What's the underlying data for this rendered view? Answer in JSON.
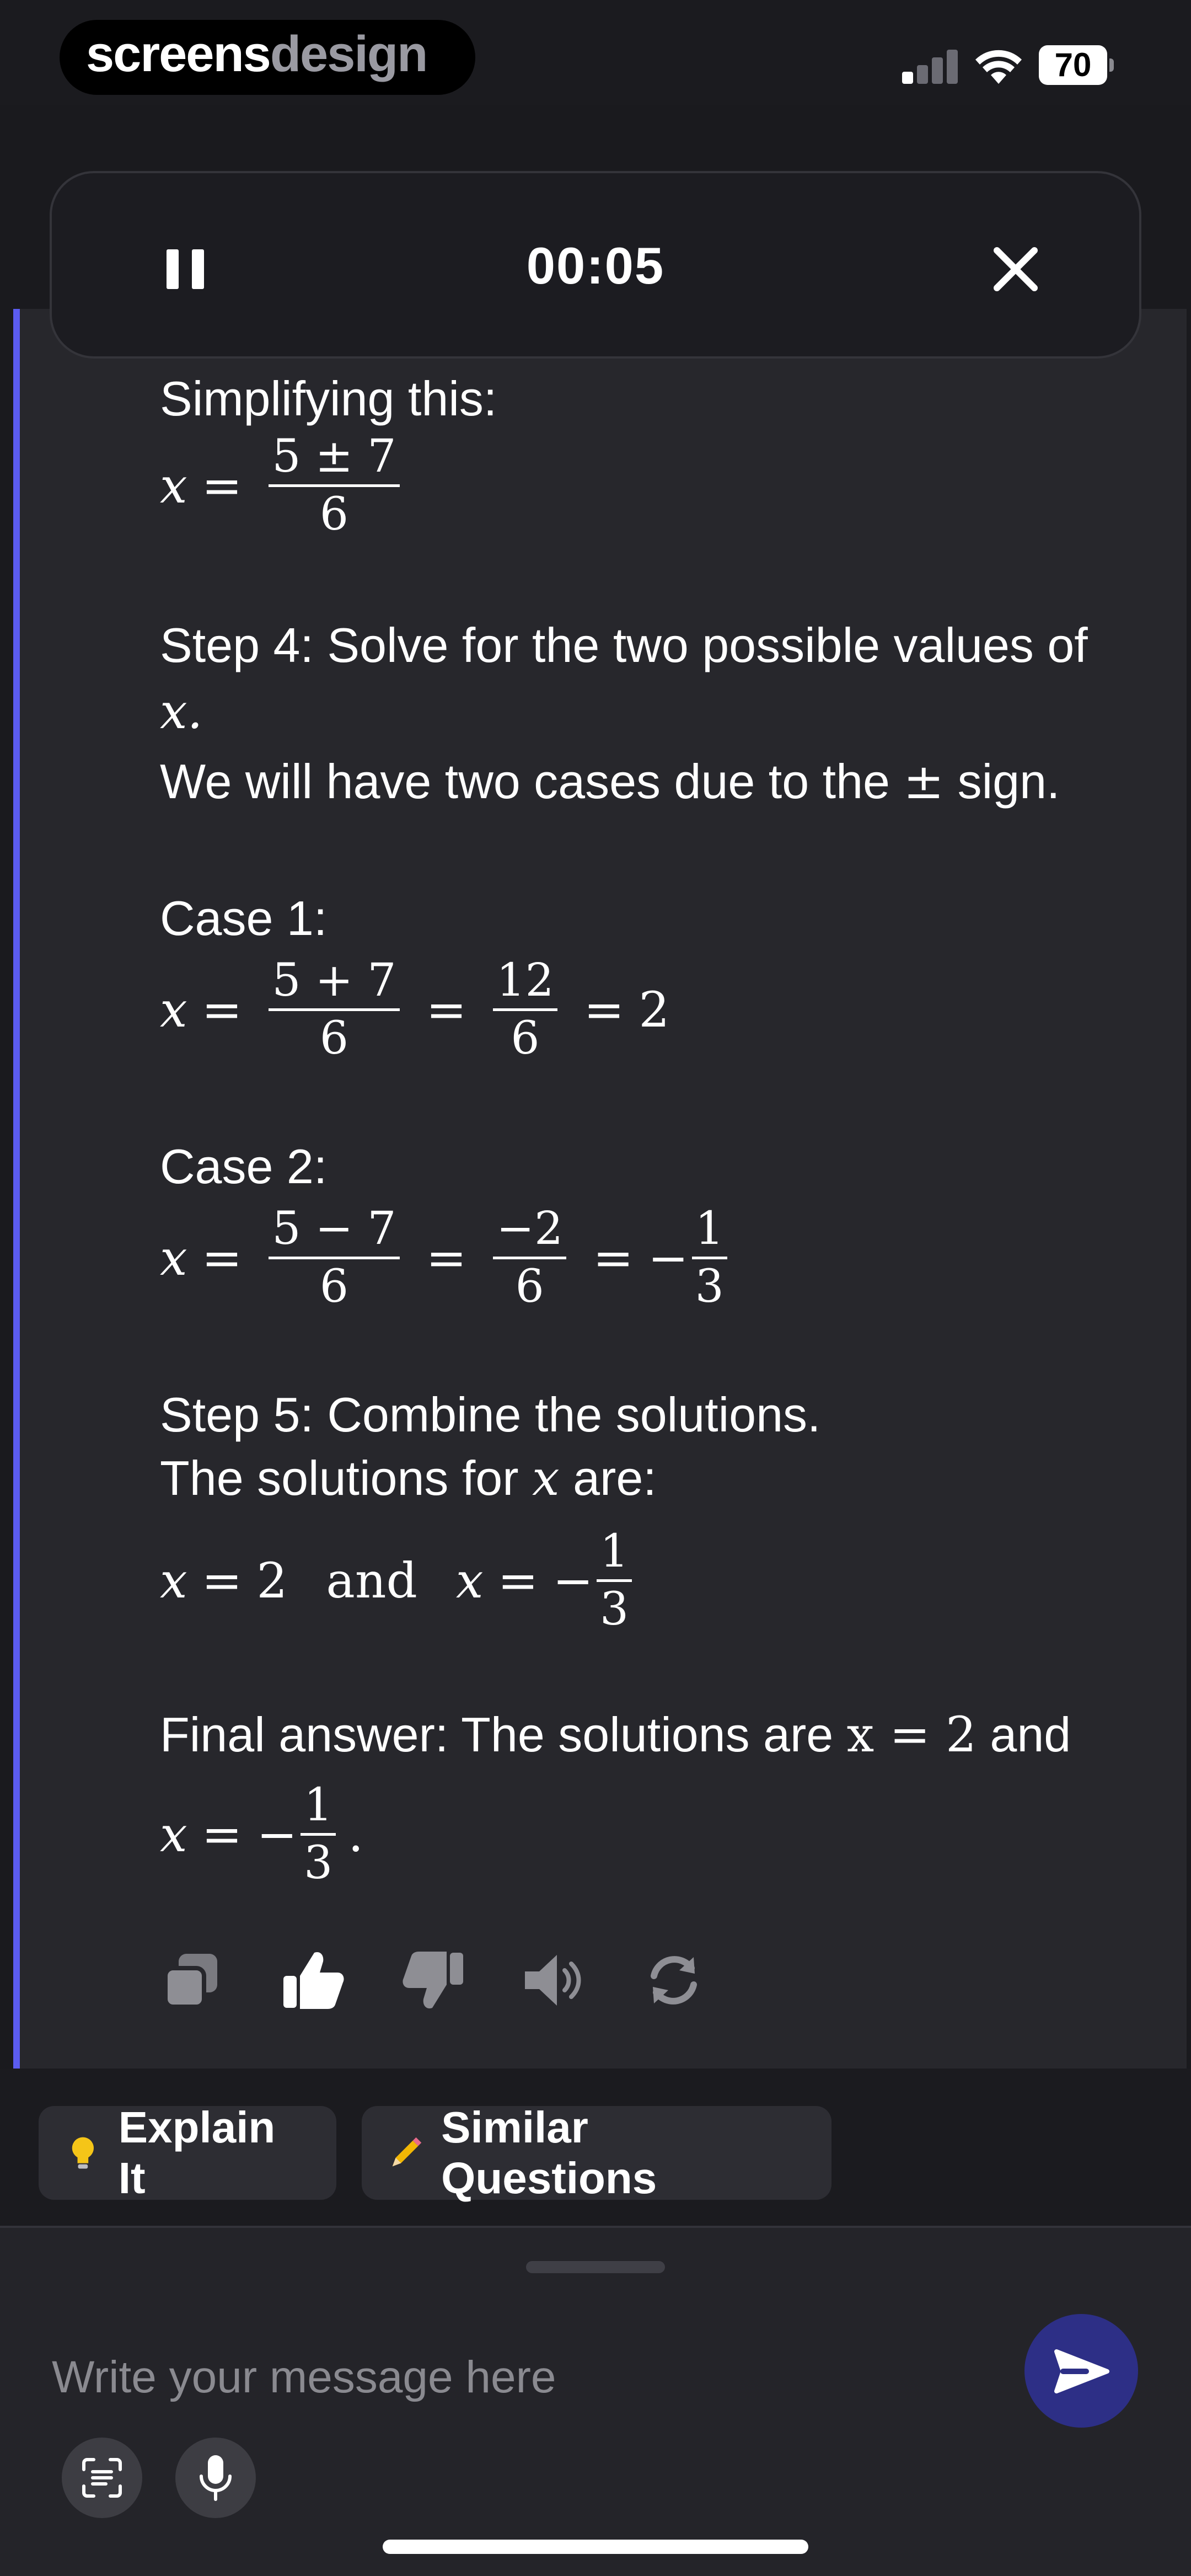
{
  "status_bar": {
    "brand_left": "screens",
    "brand_right": "design",
    "battery": "70"
  },
  "recording": {
    "timer": "00:05"
  },
  "answer": {
    "simplifying_label": "Simplifying this:",
    "step4_line1": "Step 4: Solve for the two possible values of",
    "step4_var": "x.",
    "step4_line2a": "We will have two cases due to the ",
    "step4_pm": "±",
    "step4_line2b": " sign.",
    "case1_label": "Case 1:",
    "case2_label": "Case 2:",
    "step5_label": "Step 5: Combine the solutions.",
    "solutions_for_a": "The solutions for ",
    "solutions_for_var": "x",
    "solutions_for_b": " are:",
    "final_a": "Final answer: The solutions are ",
    "final_eq": "x = 2",
    "final_b": " and",
    "math": {
      "x": "x",
      "eq": "=",
      "pm_num": "5 ± 7",
      "plus_num": "5 + 7",
      "minus_num": "5 − 7",
      "six": "6",
      "twelve": "12",
      "neg_two": "−2",
      "two": "2",
      "one": "1",
      "three": "3",
      "minus": "−",
      "and": "and",
      "period": "."
    }
  },
  "actions": {
    "copy": "copy-icon",
    "like": "thumbs-up-icon",
    "dislike": "thumbs-down-icon",
    "speaker": "speaker-icon",
    "regenerate": "regenerate-icon"
  },
  "chips": {
    "explain": "Explain It",
    "similar": "Similar Questions"
  },
  "composer": {
    "placeholder": "Write your message here"
  },
  "colors": {
    "accent": "#5b5cf0",
    "send": "#2d2f86",
    "bulb": "#f5c518",
    "pencil": "#f2b705"
  }
}
